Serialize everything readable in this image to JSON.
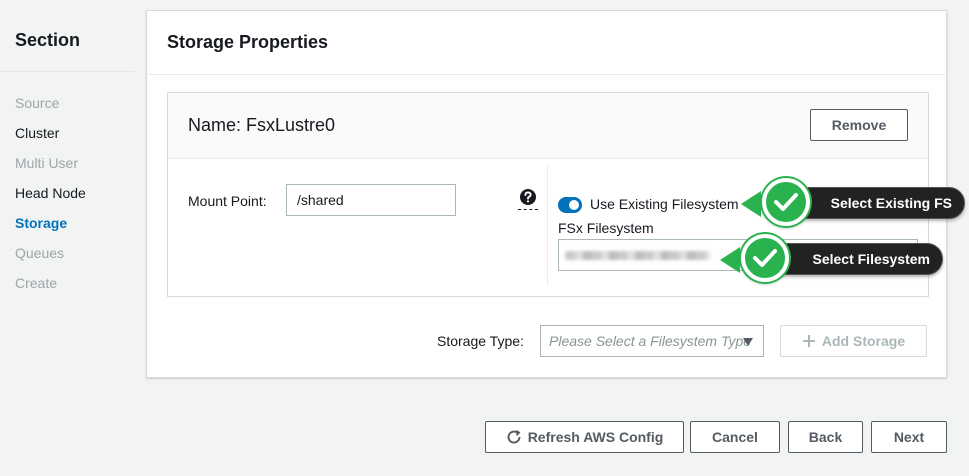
{
  "sidebar": {
    "title": "Section",
    "items": [
      {
        "label": "Source",
        "state": "disabled"
      },
      {
        "label": "Cluster",
        "state": "enabled"
      },
      {
        "label": "Multi User",
        "state": "disabled"
      },
      {
        "label": "Head Node",
        "state": "enabled"
      },
      {
        "label": "Storage",
        "state": "active"
      },
      {
        "label": "Queues",
        "state": "disabled"
      },
      {
        "label": "Create",
        "state": "disabled"
      }
    ]
  },
  "main": {
    "title": "Storage Properties",
    "storage": {
      "name": "Name: FsxLustre0",
      "remove_label": "Remove",
      "mount_label": "Mount Point:",
      "mount_value": "/shared",
      "help_icon": "question-circle-icon",
      "use_existing_label": "Use Existing Filesystem",
      "use_existing_on": true,
      "fsx_label": "FSx Filesystem"
    },
    "storage_type_label": "Storage Type:",
    "storage_type_placeholder": "Please Select a Filesystem Type",
    "add_storage_label": "Add Storage"
  },
  "footer": {
    "refresh_label": "Refresh AWS Config",
    "cancel_label": "Cancel",
    "back_label": "Back",
    "next_label": "Next"
  },
  "annotations": {
    "existing_fs": "Select Existing FS",
    "filesystem": "Select Filesystem"
  },
  "colors": {
    "accent": "#0073bb",
    "annotation_green": "#2ab24f"
  }
}
